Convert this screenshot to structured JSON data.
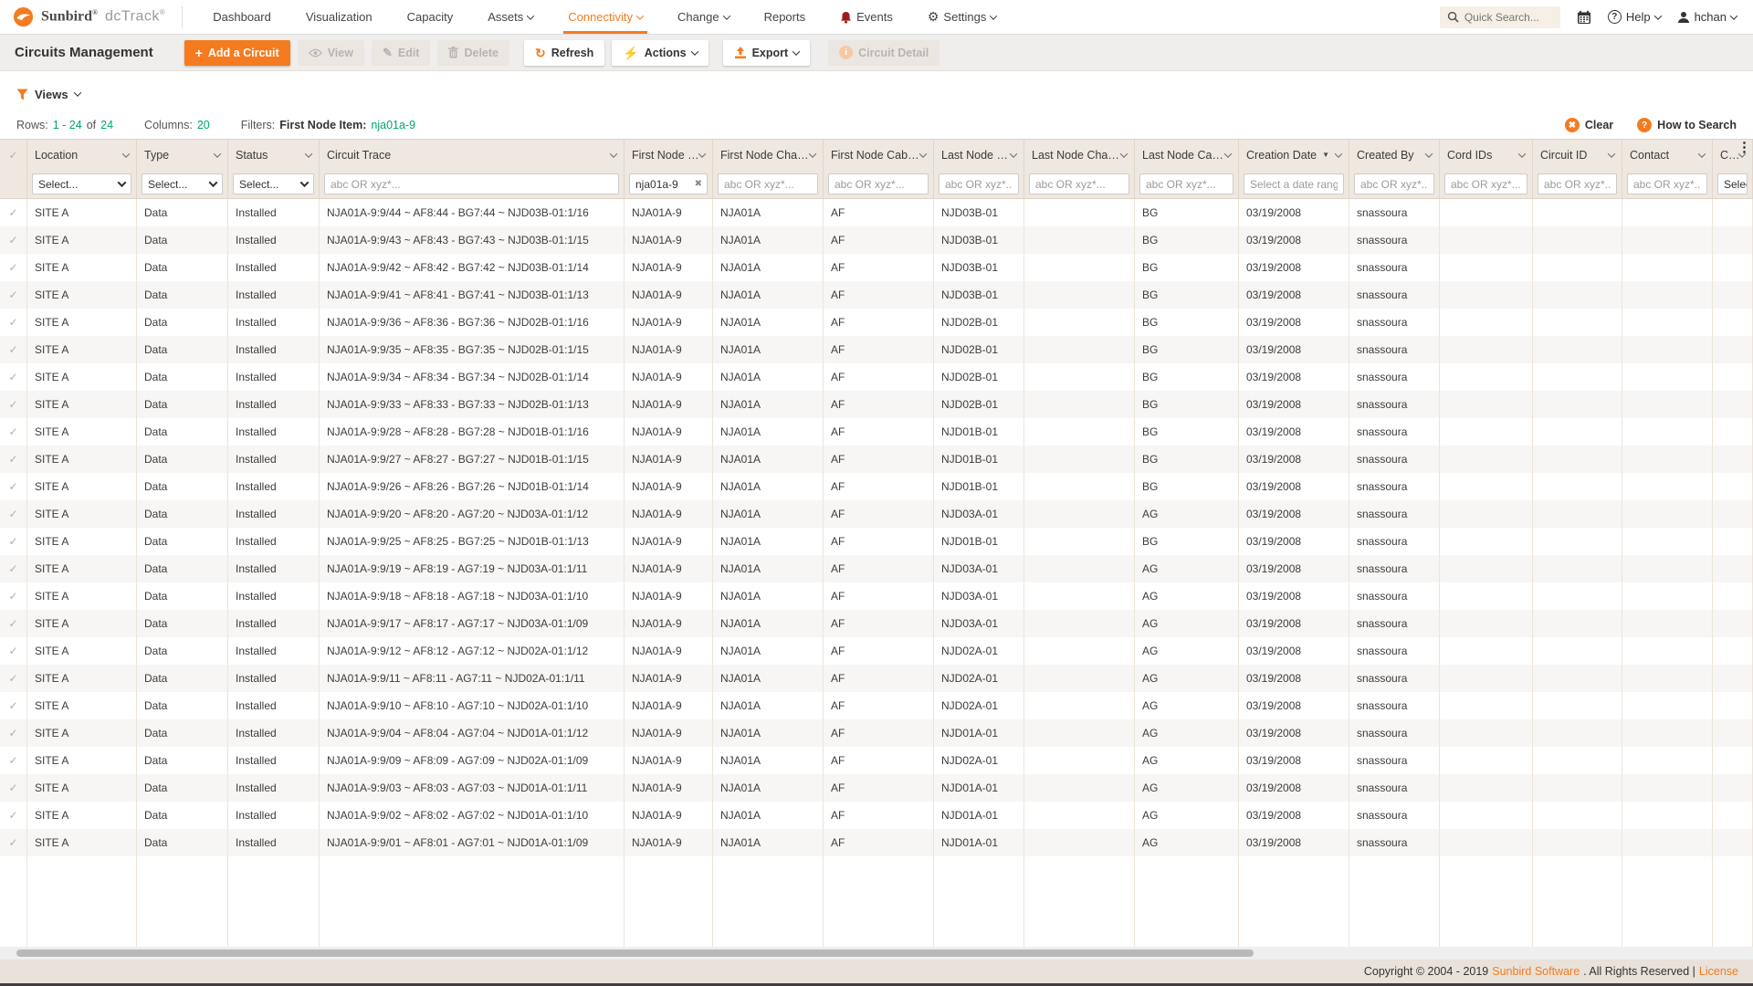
{
  "brand": {
    "name": "Sunbird",
    "reg": "®",
    "product": "dcTrack",
    "product_reg": "®"
  },
  "nav": {
    "items": [
      {
        "label": "Dashboard",
        "dropdown": false,
        "icon": null,
        "active": false
      },
      {
        "label": "Visualization",
        "dropdown": false,
        "icon": null,
        "active": false
      },
      {
        "label": "Capacity",
        "dropdown": false,
        "icon": null,
        "active": false
      },
      {
        "label": "Assets",
        "dropdown": true,
        "icon": null,
        "active": false
      },
      {
        "label": "Connectivity",
        "dropdown": true,
        "icon": null,
        "active": true
      },
      {
        "label": "Change",
        "dropdown": true,
        "icon": null,
        "active": false
      },
      {
        "label": "Reports",
        "dropdown": false,
        "icon": null,
        "active": false
      },
      {
        "label": "Events",
        "dropdown": false,
        "icon": "bell",
        "active": false
      },
      {
        "label": "Settings",
        "dropdown": true,
        "icon": "gear",
        "active": false
      }
    ]
  },
  "topbar_right": {
    "search_placeholder": "Quick Search...",
    "help_label": "Help",
    "user_name": "hchan"
  },
  "toolbar": {
    "title": "Circuits Management",
    "add_label": "Add a Circuit",
    "view_label": "View",
    "edit_label": "Edit",
    "delete_label": "Delete",
    "refresh_label": "Refresh",
    "actions_label": "Actions",
    "export_label": "Export",
    "circuit_detail_label": "Circuit Detail"
  },
  "views": {
    "label": "Views"
  },
  "summary": {
    "rows_label": "Rows:",
    "rows_range": "1 - 24",
    "of_label": "of",
    "rows_total": "24",
    "columns_label": "Columns:",
    "columns_count": "20",
    "filters_label": "Filters:",
    "filter_field": "First Node Item:",
    "filter_value": "nja01a-9",
    "clear_label": "Clear",
    "how_to_search_label": "How to Search"
  },
  "table": {
    "columns": [
      {
        "label": "",
        "type": "check"
      },
      {
        "label": "Location",
        "type": "select",
        "placeholder": "Select..."
      },
      {
        "label": "Type",
        "type": "select",
        "placeholder": "Select..."
      },
      {
        "label": "Status",
        "type": "select",
        "placeholder": "Select..."
      },
      {
        "label": "Circuit Trace",
        "type": "text",
        "placeholder": "abc OR xyz*..."
      },
      {
        "label": "First Node Item",
        "type": "text",
        "placeholder": "abc OR xyz*...",
        "value": "nja01a-9",
        "clearable": true
      },
      {
        "label": "First Node Chassis",
        "type": "text",
        "placeholder": "abc OR xyz*..."
      },
      {
        "label": "First Node Cabinet",
        "type": "text",
        "placeholder": "abc OR xyz*..."
      },
      {
        "label": "Last Node Item",
        "type": "text",
        "placeholder": "abc OR xyz*..."
      },
      {
        "label": "Last Node Chassis",
        "type": "text",
        "placeholder": "abc OR xyz*..."
      },
      {
        "label": "Last Node Cabinet",
        "type": "text",
        "placeholder": "abc OR xyz*..."
      },
      {
        "label": "Creation Date",
        "type": "date",
        "placeholder": "Select a date range",
        "sort": "desc"
      },
      {
        "label": "Created By",
        "type": "text",
        "placeholder": "abc OR xyz*..."
      },
      {
        "label": "Cord IDs",
        "type": "text",
        "placeholder": "abc OR xyz*..."
      },
      {
        "label": "Circuit ID",
        "type": "text",
        "placeholder": "abc OR xyz*..."
      },
      {
        "label": "Contact",
        "type": "text",
        "placeholder": "abc OR xyz*..."
      },
      {
        "label": "Cont",
        "type": "select",
        "placeholder": "Select...",
        "kebab": true
      }
    ],
    "rows": [
      [
        "SITE A",
        "Data",
        "Installed",
        "NJA01A-9:9/44 ~ AF8:44 - BG7:44 ~ NJD03B-01:1/16",
        "NJA01A-9",
        "NJA01A",
        "AF",
        "NJD03B-01",
        "",
        "BG",
        "03/19/2008",
        "snassoura",
        "",
        "",
        "",
        ""
      ],
      [
        "SITE A",
        "Data",
        "Installed",
        "NJA01A-9:9/43 ~ AF8:43 - BG7:43 ~ NJD03B-01:1/15",
        "NJA01A-9",
        "NJA01A",
        "AF",
        "NJD03B-01",
        "",
        "BG",
        "03/19/2008",
        "snassoura",
        "",
        "",
        "",
        ""
      ],
      [
        "SITE A",
        "Data",
        "Installed",
        "NJA01A-9:9/42 ~ AF8:42 - BG7:42 ~ NJD03B-01:1/14",
        "NJA01A-9",
        "NJA01A",
        "AF",
        "NJD03B-01",
        "",
        "BG",
        "03/19/2008",
        "snassoura",
        "",
        "",
        "",
        ""
      ],
      [
        "SITE A",
        "Data",
        "Installed",
        "NJA01A-9:9/41 ~ AF8:41 - BG7:41 ~ NJD03B-01:1/13",
        "NJA01A-9",
        "NJA01A",
        "AF",
        "NJD03B-01",
        "",
        "BG",
        "03/19/2008",
        "snassoura",
        "",
        "",
        "",
        ""
      ],
      [
        "SITE A",
        "Data",
        "Installed",
        "NJA01A-9:9/36 ~ AF8:36 - BG7:36 ~ NJD02B-01:1/16",
        "NJA01A-9",
        "NJA01A",
        "AF",
        "NJD02B-01",
        "",
        "BG",
        "03/19/2008",
        "snassoura",
        "",
        "",
        "",
        ""
      ],
      [
        "SITE A",
        "Data",
        "Installed",
        "NJA01A-9:9/35 ~ AF8:35 - BG7:35 ~ NJD02B-01:1/15",
        "NJA01A-9",
        "NJA01A",
        "AF",
        "NJD02B-01",
        "",
        "BG",
        "03/19/2008",
        "snassoura",
        "",
        "",
        "",
        ""
      ],
      [
        "SITE A",
        "Data",
        "Installed",
        "NJA01A-9:9/34 ~ AF8:34 - BG7:34 ~ NJD02B-01:1/14",
        "NJA01A-9",
        "NJA01A",
        "AF",
        "NJD02B-01",
        "",
        "BG",
        "03/19/2008",
        "snassoura",
        "",
        "",
        "",
        ""
      ],
      [
        "SITE A",
        "Data",
        "Installed",
        "NJA01A-9:9/33 ~ AF8:33 - BG7:33 ~ NJD02B-01:1/13",
        "NJA01A-9",
        "NJA01A",
        "AF",
        "NJD02B-01",
        "",
        "BG",
        "03/19/2008",
        "snassoura",
        "",
        "",
        "",
        ""
      ],
      [
        "SITE A",
        "Data",
        "Installed",
        "NJA01A-9:9/28 ~ AF8:28 - BG7:28 ~ NJD01B-01:1/16",
        "NJA01A-9",
        "NJA01A",
        "AF",
        "NJD01B-01",
        "",
        "BG",
        "03/19/2008",
        "snassoura",
        "",
        "",
        "",
        ""
      ],
      [
        "SITE A",
        "Data",
        "Installed",
        "NJA01A-9:9/27 ~ AF8:27 - BG7:27 ~ NJD01B-01:1/15",
        "NJA01A-9",
        "NJA01A",
        "AF",
        "NJD01B-01",
        "",
        "BG",
        "03/19/2008",
        "snassoura",
        "",
        "",
        "",
        ""
      ],
      [
        "SITE A",
        "Data",
        "Installed",
        "NJA01A-9:9/26 ~ AF8:26 - BG7:26 ~ NJD01B-01:1/14",
        "NJA01A-9",
        "NJA01A",
        "AF",
        "NJD01B-01",
        "",
        "BG",
        "03/19/2008",
        "snassoura",
        "",
        "",
        "",
        ""
      ],
      [
        "SITE A",
        "Data",
        "Installed",
        "NJA01A-9:9/20 ~ AF8:20 - AG7:20 ~ NJD03A-01:1/12",
        "NJA01A-9",
        "NJA01A",
        "AF",
        "NJD03A-01",
        "",
        "AG",
        "03/19/2008",
        "snassoura",
        "",
        "",
        "",
        ""
      ],
      [
        "SITE A",
        "Data",
        "Installed",
        "NJA01A-9:9/25 ~ AF8:25 - BG7:25 ~ NJD01B-01:1/13",
        "NJA01A-9",
        "NJA01A",
        "AF",
        "NJD01B-01",
        "",
        "BG",
        "03/19/2008",
        "snassoura",
        "",
        "",
        "",
        ""
      ],
      [
        "SITE A",
        "Data",
        "Installed",
        "NJA01A-9:9/19 ~ AF8:19 - AG7:19 ~ NJD03A-01:1/11",
        "NJA01A-9",
        "NJA01A",
        "AF",
        "NJD03A-01",
        "",
        "AG",
        "03/19/2008",
        "snassoura",
        "",
        "",
        "",
        ""
      ],
      [
        "SITE A",
        "Data",
        "Installed",
        "NJA01A-9:9/18 ~ AF8:18 - AG7:18 ~ NJD03A-01:1/10",
        "NJA01A-9",
        "NJA01A",
        "AF",
        "NJD03A-01",
        "",
        "AG",
        "03/19/2008",
        "snassoura",
        "",
        "",
        "",
        ""
      ],
      [
        "SITE A",
        "Data",
        "Installed",
        "NJA01A-9:9/17 ~ AF8:17 - AG7:17 ~ NJD03A-01:1/09",
        "NJA01A-9",
        "NJA01A",
        "AF",
        "NJD03A-01",
        "",
        "AG",
        "03/19/2008",
        "snassoura",
        "",
        "",
        "",
        ""
      ],
      [
        "SITE A",
        "Data",
        "Installed",
        "NJA01A-9:9/12 ~ AF8:12 - AG7:12 ~ NJD02A-01:1/12",
        "NJA01A-9",
        "NJA01A",
        "AF",
        "NJD02A-01",
        "",
        "AG",
        "03/19/2008",
        "snassoura",
        "",
        "",
        "",
        ""
      ],
      [
        "SITE A",
        "Data",
        "Installed",
        "NJA01A-9:9/11 ~ AF8:11 - AG7:11 ~ NJD02A-01:1/11",
        "NJA01A-9",
        "NJA01A",
        "AF",
        "NJD02A-01",
        "",
        "AG",
        "03/19/2008",
        "snassoura",
        "",
        "",
        "",
        ""
      ],
      [
        "SITE A",
        "Data",
        "Installed",
        "NJA01A-9:9/10 ~ AF8:10 - AG7:10 ~ NJD02A-01:1/10",
        "NJA01A-9",
        "NJA01A",
        "AF",
        "NJD02A-01",
        "",
        "AG",
        "03/19/2008",
        "snassoura",
        "",
        "",
        "",
        ""
      ],
      [
        "SITE A",
        "Data",
        "Installed",
        "NJA01A-9:9/04 ~ AF8:04 - AG7:04 ~ NJD01A-01:1/12",
        "NJA01A-9",
        "NJA01A",
        "AF",
        "NJD01A-01",
        "",
        "AG",
        "03/19/2008",
        "snassoura",
        "",
        "",
        "",
        ""
      ],
      [
        "SITE A",
        "Data",
        "Installed",
        "NJA01A-9:9/09 ~ AF8:09 - AG7:09 ~ NJD02A-01:1/09",
        "NJA01A-9",
        "NJA01A",
        "AF",
        "NJD02A-01",
        "",
        "AG",
        "03/19/2008",
        "snassoura",
        "",
        "",
        "",
        ""
      ],
      [
        "SITE A",
        "Data",
        "Installed",
        "NJA01A-9:9/03 ~ AF8:03 - AG7:03 ~ NJD01A-01:1/11",
        "NJA01A-9",
        "NJA01A",
        "AF",
        "NJD01A-01",
        "",
        "AG",
        "03/19/2008",
        "snassoura",
        "",
        "",
        "",
        ""
      ],
      [
        "SITE A",
        "Data",
        "Installed",
        "NJA01A-9:9/02 ~ AF8:02 - AG7:02 ~ NJD01A-01:1/10",
        "NJA01A-9",
        "NJA01A",
        "AF",
        "NJD01A-01",
        "",
        "AG",
        "03/19/2008",
        "snassoura",
        "",
        "",
        "",
        ""
      ],
      [
        "SITE A",
        "Data",
        "Installed",
        "NJA01A-9:9/01 ~ AF8:01 - AG7:01 ~ NJD01A-01:1/09",
        "NJA01A-9",
        "NJA01A",
        "AF",
        "NJD01A-01",
        "",
        "AG",
        "03/19/2008",
        "snassoura",
        "",
        "",
        "",
        ""
      ]
    ]
  },
  "footer": {
    "copyright_prefix": "Copyright © 2004 - 2019",
    "company": "Sunbird Software",
    "rights": ". All Rights Reserved |",
    "license": "License"
  },
  "colors": {
    "accent": "#f47b20",
    "green": "#00a56e",
    "header_bg": "#efe8e0",
    "footer_bg": "#e9e2da"
  }
}
